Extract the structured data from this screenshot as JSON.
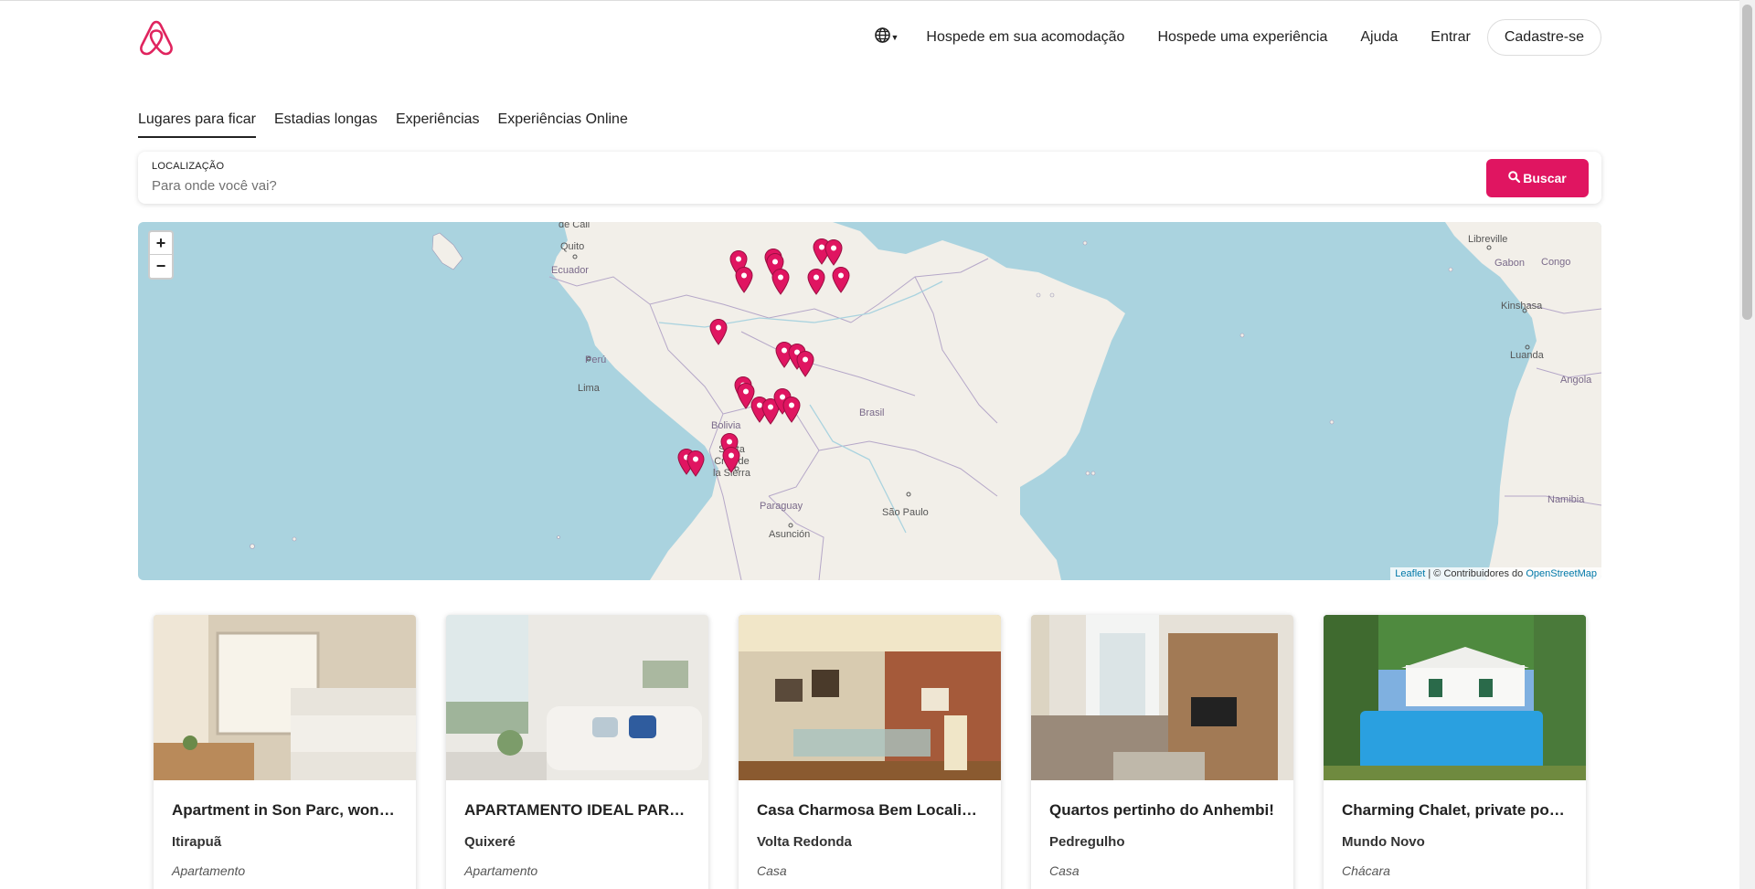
{
  "header": {
    "nav_host_stay": "Hospede em sua acomodação",
    "nav_host_experience": "Hospede uma experiência",
    "nav_help": "Ajuda",
    "nav_login": "Entrar",
    "nav_signup": "Cadastre-se"
  },
  "tabs": [
    {
      "label": "Lugares para ficar",
      "active": true
    },
    {
      "label": "Estadias longas",
      "active": false
    },
    {
      "label": "Experiências",
      "active": false
    },
    {
      "label": "Experiências Online",
      "active": false
    }
  ],
  "search": {
    "label": "LOCALIZAÇÃO",
    "placeholder": "Para onde você vai?",
    "button_label": "Buscar"
  },
  "map": {
    "zoom_in": "+",
    "zoom_out": "−",
    "attribution_leaflet": "Leaflet",
    "attribution_sep": " | © Contribuidores do ",
    "attribution_osm": "OpenStreetMap",
    "labels": {
      "cali": "de Cali",
      "quito": "Quito",
      "ecuador": "Ecuador",
      "peru": "Perú",
      "lima": "Lima",
      "bolivia": "Bolivia",
      "santa_cruz": "Santa\nCruz de\nla Sierra",
      "paraguay": "Paraguay",
      "asuncion": "Asunción",
      "brasil": "Brasil",
      "sao_paulo": "São Paulo",
      "libreville": "Libreville",
      "gabon": "Gabon",
      "congo": "Congo",
      "kinshasa": "Kinshasa",
      "luanda": "Luanda",
      "angola": "Angola",
      "namibia": "Namibia"
    }
  },
  "listings": [
    {
      "title": "Apartment in Son Parc, wonde...",
      "city": "Itirapuã",
      "kind": "Apartamento"
    },
    {
      "title": "APARTAMENTO IDEAL PAREJ...",
      "city": "Quixeré",
      "kind": "Apartamento"
    },
    {
      "title": "Casa Charmosa Bem Localizada",
      "city": "Volta Redonda",
      "kind": "Casa"
    },
    {
      "title": "Quartos pertinho do Anhembi!",
      "city": "Pedregulho",
      "kind": "Casa"
    },
    {
      "title": "Charming Chalet, private pool,...",
      "city": "Mundo Novo",
      "kind": "Chácara"
    }
  ],
  "colors": {
    "brand": "#e01561",
    "ocean": "#aad3df",
    "land": "#f2efe9"
  }
}
